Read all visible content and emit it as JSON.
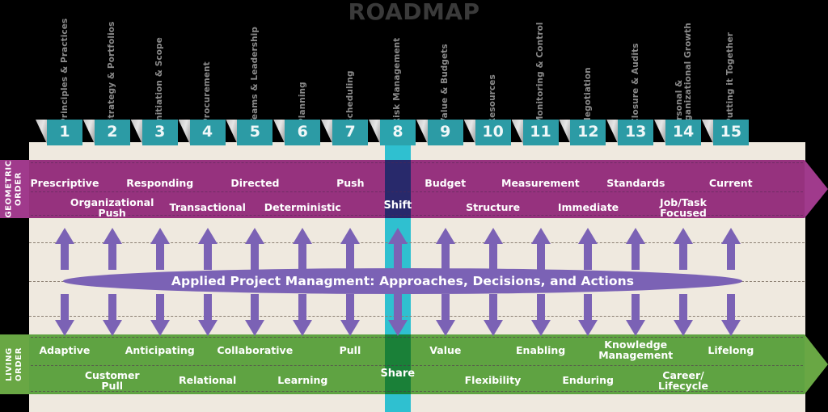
{
  "title": "ROADMAP",
  "colors": {
    "teal_tab": "#2c9ba5",
    "highlight_column": "#2fc0d0",
    "geometric_band": "#96327e",
    "geometric_label": "#a03a8c",
    "geometric_pivot": "#28296b",
    "living_band": "#5fa342",
    "living_label": "#69a744",
    "living_pivot": "#1a8038",
    "canvas": "#efe9df",
    "ellipse": "#7b62b5",
    "arrow": "#7b62b5",
    "title_text": "#3a3a3a"
  },
  "columns": [
    {
      "number": "1",
      "label": "Principles & Practices"
    },
    {
      "number": "2",
      "label": "Strategy & Portfolios"
    },
    {
      "number": "3",
      "label": "Initiation & Scope"
    },
    {
      "number": "4",
      "label": "Procurement"
    },
    {
      "number": "5",
      "label": "Teams & Leadership"
    },
    {
      "number": "6",
      "label": "Planning"
    },
    {
      "number": "7",
      "label": "Scheduling"
    },
    {
      "number": "8",
      "label": "Risk Management"
    },
    {
      "number": "9",
      "label": "Value & Budgets"
    },
    {
      "number": "10",
      "label": "Resources"
    },
    {
      "number": "11",
      "label": "Monitoring & Control"
    },
    {
      "number": "12",
      "label": "Negotiation"
    },
    {
      "number": "13",
      "label": "Closure & Audits"
    },
    {
      "number": "14",
      "label": "Personal &\nOrganizational Growth"
    },
    {
      "number": "15",
      "label": "Putting it Together"
    }
  ],
  "geometric": {
    "side_label": "GEOMETRIC\nORDER",
    "pivot": "Shift",
    "row_top": [
      "Prescriptive",
      "Responding",
      "Directed",
      "Push",
      "Budget",
      "Measurement",
      "Standards",
      "Current"
    ],
    "row_bottom": [
      "Organizational\nPush",
      "Transactional",
      "Deterministic",
      "Structure",
      "Immediate",
      "Job/Task\nFocused"
    ]
  },
  "living": {
    "side_label": "LIVING\nORDER",
    "pivot": "Share",
    "row_top": [
      "Adaptive",
      "Anticipating",
      "Collaborative",
      "Pull",
      "Value",
      "Enabling",
      "Knowledge\nManagement",
      "Lifelong"
    ],
    "row_bottom": [
      "Customer\nPull",
      "Relational",
      "Learning",
      "Flexibility",
      "Enduring",
      "Career/\nLifecycle"
    ]
  },
  "center": {
    "ellipse_text": "Applied Project Managment: Approaches, Decisions, and Actions",
    "arrow_up_count": 15,
    "arrow_down_count": 15
  }
}
